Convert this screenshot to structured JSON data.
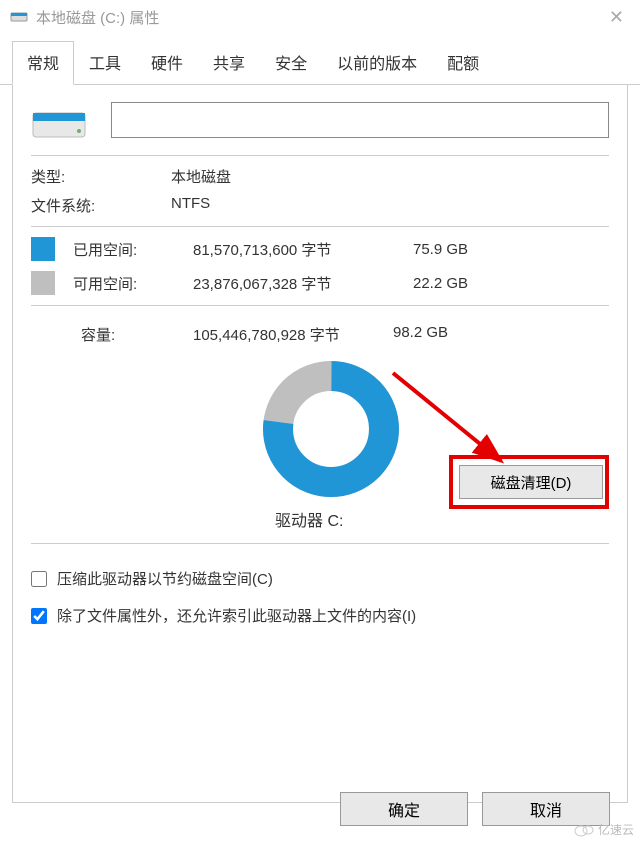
{
  "window": {
    "title": "本地磁盘 (C:) 属性"
  },
  "tabs": [
    "常规",
    "工具",
    "硬件",
    "共享",
    "安全",
    "以前的版本",
    "配额"
  ],
  "general": {
    "name_value": "",
    "type_label": "类型:",
    "type_value": "本地磁盘",
    "fs_label": "文件系统:",
    "fs_value": "NTFS",
    "used_label": "已用空间:",
    "used_bytes": "81,570,713,600 字节",
    "used_gb": "75.9 GB",
    "free_label": "可用空间:",
    "free_bytes": "23,876,067,328 字节",
    "free_gb": "22.2 GB",
    "cap_label": "容量:",
    "cap_bytes": "105,446,780,928 字节",
    "cap_gb": "98.2 GB",
    "drive_label": "驱动器 C:",
    "cleanup_btn": "磁盘清理(D)",
    "compress_label": "压缩此驱动器以节约磁盘空间(C)",
    "index_label": "除了文件属性外，还允许索引此驱动器上文件的内容(I)",
    "compress_checked": false,
    "index_checked": true
  },
  "buttons": {
    "ok": "确定",
    "cancel": "取消"
  },
  "chart_data": {
    "type": "pie",
    "title": "驱动器 C:",
    "series": [
      {
        "name": "已用空间",
        "value": 75.9,
        "color": "#2196d6"
      },
      {
        "name": "可用空间",
        "value": 22.2,
        "color": "#bfbfbf"
      }
    ],
    "unit": "GB",
    "total": 98.2
  },
  "watermark": "亿速云"
}
